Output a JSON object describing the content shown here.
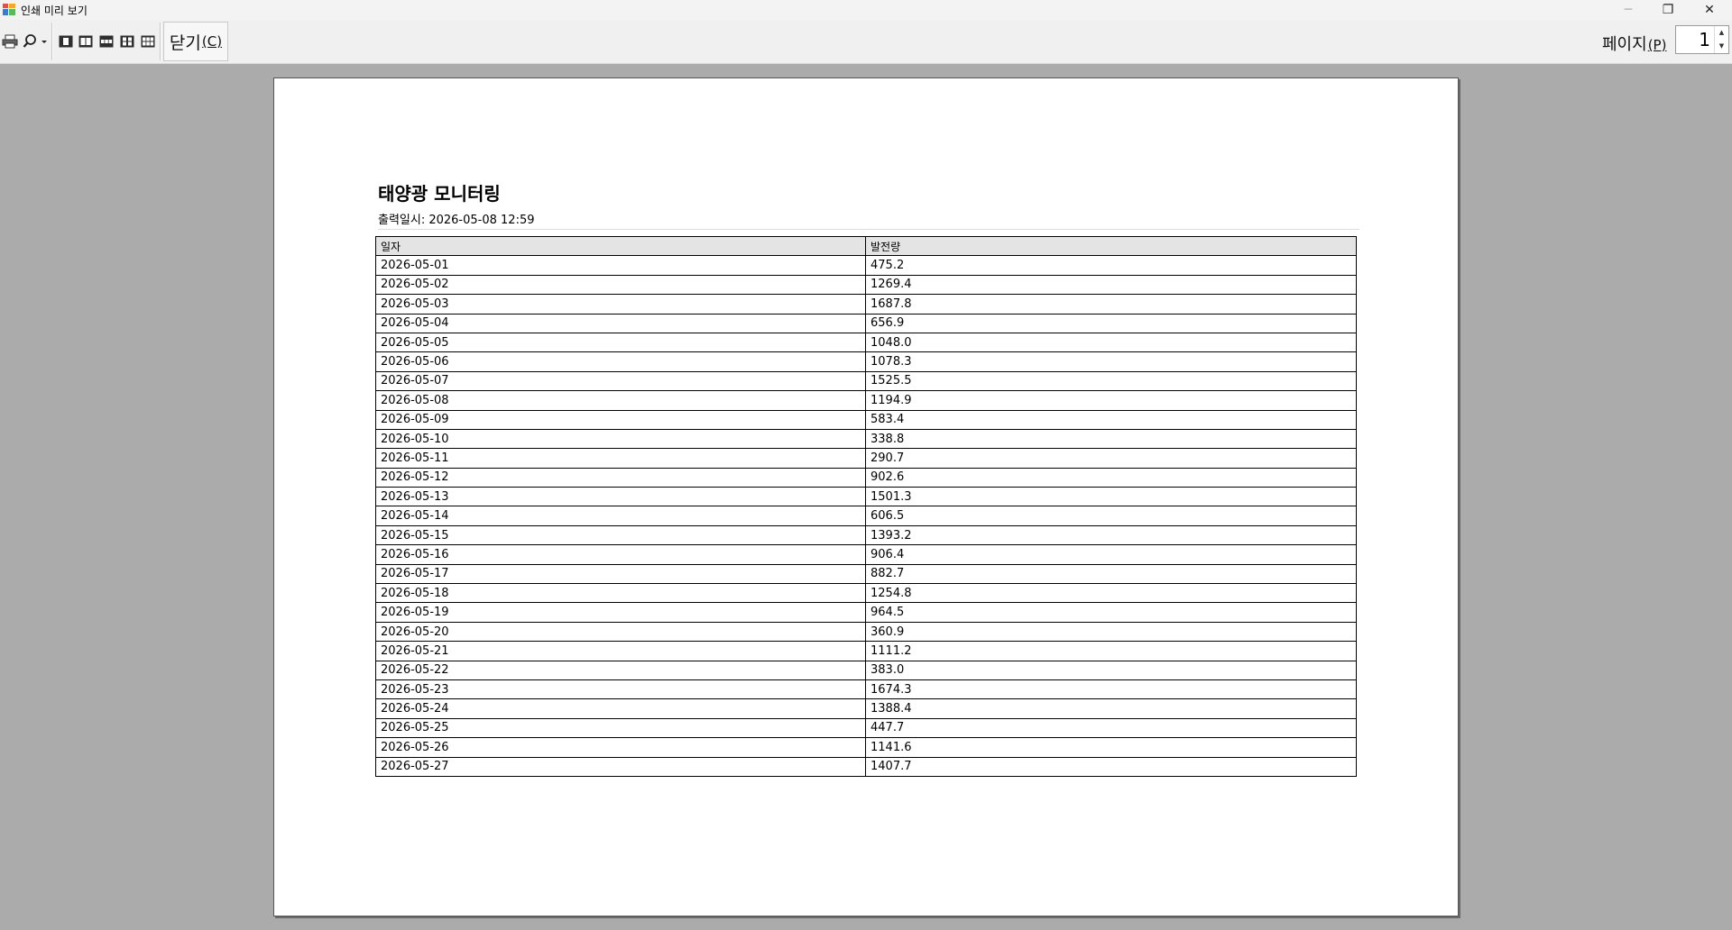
{
  "window": {
    "title": "인쇄 미리 보기",
    "minimize_glyph": "─",
    "maximize_glyph": "❐",
    "close_glyph": "✕"
  },
  "toolbar": {
    "icons": [
      "printer-icon",
      "zoom-icon",
      "one-page-icon",
      "two-pages-icon",
      "three-pages-icon",
      "four-pages-icon",
      "six-pages-icon"
    ],
    "close_label": "닫기",
    "close_accel": "(C)",
    "page_label": "페이지",
    "page_accel": "(P)",
    "page_value": "1",
    "spin_up": "▲",
    "spin_down": "▼"
  },
  "document": {
    "title": "태양광 모니터링",
    "printed_at": "출력일시: 2026-05-08 12:59",
    "columns": [
      "일자",
      "발전량"
    ],
    "rows": [
      [
        "2026-05-01",
        "475.2"
      ],
      [
        "2026-05-02",
        "1269.4"
      ],
      [
        "2026-05-03",
        "1687.8"
      ],
      [
        "2026-05-04",
        "656.9"
      ],
      [
        "2026-05-05",
        "1048.0"
      ],
      [
        "2026-05-06",
        "1078.3"
      ],
      [
        "2026-05-07",
        "1525.5"
      ],
      [
        "2026-05-08",
        "1194.9"
      ],
      [
        "2026-05-09",
        "583.4"
      ],
      [
        "2026-05-10",
        "338.8"
      ],
      [
        "2026-05-11",
        "290.7"
      ],
      [
        "2026-05-12",
        "902.6"
      ],
      [
        "2026-05-13",
        "1501.3"
      ],
      [
        "2026-05-14",
        "606.5"
      ],
      [
        "2026-05-15",
        "1393.2"
      ],
      [
        "2026-05-16",
        "906.4"
      ],
      [
        "2026-05-17",
        "882.7"
      ],
      [
        "2026-05-18",
        "1254.8"
      ],
      [
        "2026-05-19",
        "964.5"
      ],
      [
        "2026-05-20",
        "360.9"
      ],
      [
        "2026-05-21",
        "1111.2"
      ],
      [
        "2026-05-22",
        "383.0"
      ],
      [
        "2026-05-23",
        "1674.3"
      ],
      [
        "2026-05-24",
        "1388.4"
      ],
      [
        "2026-05-25",
        "447.7"
      ],
      [
        "2026-05-26",
        "1141.6"
      ],
      [
        "2026-05-27",
        "1407.7"
      ]
    ]
  }
}
